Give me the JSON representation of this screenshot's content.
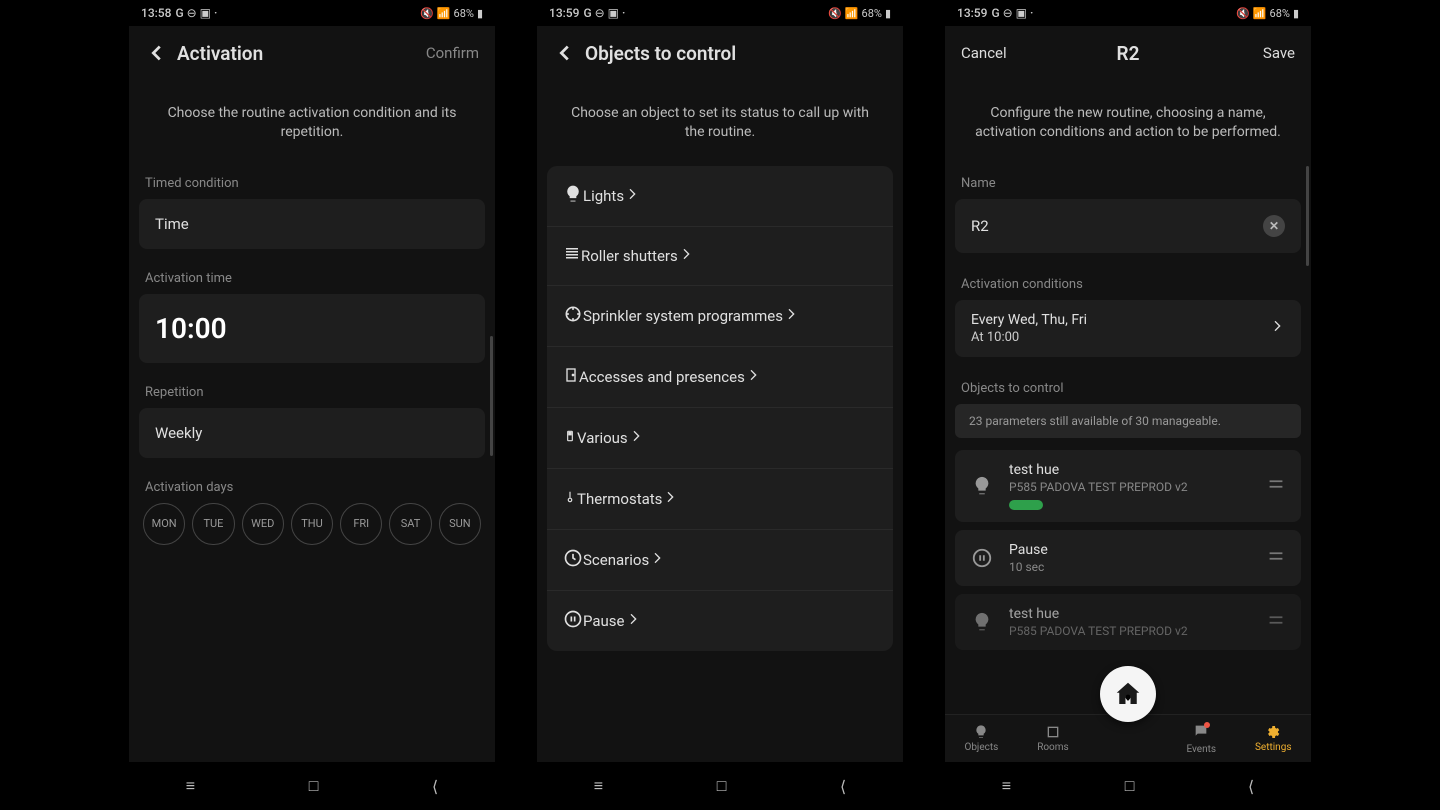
{
  "status": {
    "time": "13:58",
    "time2": "13:59",
    "time3": "13:59",
    "battery": "68%"
  },
  "screen1": {
    "title": "Activation",
    "confirm": "Confirm",
    "subtitle": "Choose the routine activation condition and its repetition.",
    "sections": {
      "timed": "Timed condition",
      "time": "Time",
      "activation_time_label": "Activation time",
      "activation_time_value": "10:00",
      "repetition_label": "Repetition",
      "repetition_value": "Weekly",
      "activation_days": "Activation days",
      "days": [
        "MON",
        "TUE",
        "WED",
        "THU",
        "FRI",
        "SAT",
        "SUN"
      ]
    }
  },
  "screen2": {
    "title": "Objects to control",
    "subtitle": "Choose an object to set its status to call up with the routine.",
    "items": [
      "Lights",
      "Roller shutters",
      "Sprinkler system programmes",
      "Accesses and presences",
      "Various",
      "Thermostats",
      "Scenarios",
      "Pause"
    ]
  },
  "screen3": {
    "cancel": "Cancel",
    "title": "R2",
    "save": "Save",
    "subtitle": "Configure the new routine, choosing a name, activation conditions and action to be performed.",
    "name_label": "Name",
    "name_value": "R2",
    "activation_conditions_label": "Activation conditions",
    "cond_line1": "Every Wed, Thu, Fri",
    "cond_line2": "At 10:00",
    "objects_label": "Objects to control",
    "params_text": "23 parameters still available of 30 manageable.",
    "objects": [
      {
        "name": "test hue",
        "sub": "P585 PADOVA TEST PREPROD v2",
        "status": "on",
        "icon": "bulb"
      },
      {
        "name": "Pause",
        "sub": "10 sec",
        "icon": "pause"
      },
      {
        "name": "test hue",
        "sub": "P585 PADOVA TEST PREPROD v2",
        "icon": "bulb"
      }
    ],
    "tabs": {
      "objects": "Objects",
      "rooms": "Rooms",
      "events": "Events",
      "settings": "Settings"
    }
  }
}
